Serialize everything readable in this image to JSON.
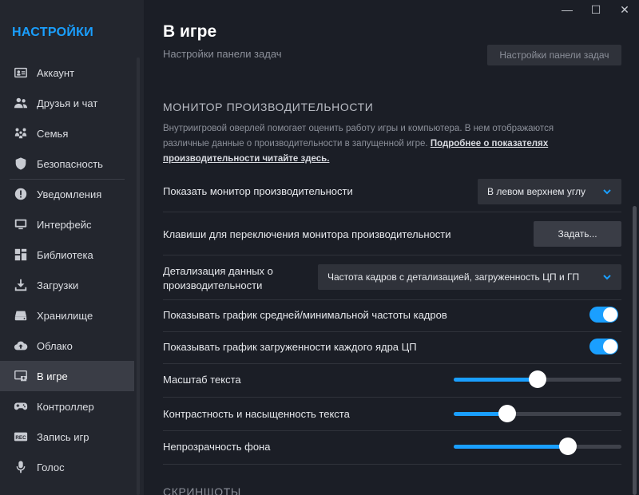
{
  "window": {
    "minimize": "—",
    "maximize": "☐",
    "close": "✕"
  },
  "sidebar": {
    "title": "НАСТРОЙКИ",
    "items": [
      {
        "label": "Аккаунт",
        "icon": "account-card-icon"
      },
      {
        "label": "Друзья и чат",
        "icon": "friends-icon"
      },
      {
        "label": "Семья",
        "icon": "family-icon"
      },
      {
        "label": "Безопасность",
        "icon": "shield-icon"
      },
      {
        "label": "Уведомления",
        "icon": "notification-icon"
      },
      {
        "label": "Интерфейс",
        "icon": "monitor-icon"
      },
      {
        "label": "Библиотека",
        "icon": "library-grid-icon"
      },
      {
        "label": "Загрузки",
        "icon": "download-icon"
      },
      {
        "label": "Хранилище",
        "icon": "storage-drive-icon"
      },
      {
        "label": "Облако",
        "icon": "cloud-icon"
      },
      {
        "label": "В игре",
        "icon": "in-game-icon",
        "active": true
      },
      {
        "label": "Контроллер",
        "icon": "gamepad-icon"
      },
      {
        "label": "Запись игр",
        "icon": "rec-icon"
      },
      {
        "label": "Голос",
        "icon": "microphone-icon"
      }
    ]
  },
  "main": {
    "title": "В игре",
    "partial_row": {
      "label": "Настройки панели задач",
      "button": "Настройки панели задач"
    },
    "section": {
      "heading": "МОНИТОР ПРОИЗВОДИТЕЛЬНОСТИ",
      "description": "Внутриигровой оверлей помогает оценить работу игры и компьютера. В нем отображаются различные данные о производительности в запущенной игре. ",
      "link": "Подробнее о показателях производительности читайте здесь."
    },
    "rows": {
      "show_monitor": {
        "label": "Показать монитор производительности",
        "value": "В левом верхнем углу"
      },
      "hotkey": {
        "label": "Клавиши для переключения монитора производительности",
        "button": "Задать..."
      },
      "detail": {
        "label": "Детализация данных о производительности",
        "value": "Частота кадров с детализацией, загруженность ЦП и ГП"
      },
      "fps_graph": {
        "label": "Показывать график средней/минимальной частоты кадров",
        "on": true
      },
      "cpu_graph": {
        "label": "Показывать график загруженности каждого ядра ЦП",
        "on": true
      },
      "text_scale": {
        "label": "Масштаб текста",
        "level": 0.5
      },
      "text_contrast": {
        "label": "Контрастность и насыщенность текста",
        "level": 0.32
      },
      "bg_opacity": {
        "label": "Непрозрачность фона",
        "level": 0.68
      }
    },
    "next_section": "СКРИНШОТЫ"
  },
  "colors": {
    "accent": "#1a9fff",
    "bg": "#1b1e26",
    "sidebar": "#23262e"
  }
}
